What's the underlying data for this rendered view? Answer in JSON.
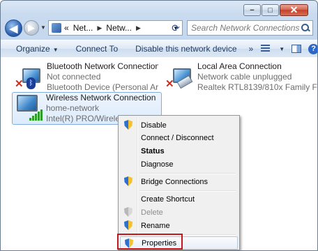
{
  "window": {
    "caption": {
      "minimize": "−",
      "maximize": "□",
      "close": "✕"
    }
  },
  "nav": {
    "back_glyph": "◀",
    "forward_glyph": "▶",
    "address": {
      "prefix": "«",
      "crumbs": [
        "Net...",
        "Netw..."
      ]
    },
    "search_placeholder": "Search Network Connections"
  },
  "toolbar": {
    "organize": "Organize",
    "connect_to": "Connect To",
    "disable": "Disable this network device",
    "more": "»"
  },
  "connections": [
    {
      "name": "Bluetooth Network Connection",
      "status": "Not connected",
      "device": "Bluetooth Device (Personal Area ..."
    },
    {
      "name": "Local Area Connection",
      "status": "Network cable unplugged",
      "device": "Realtek RTL8139/810x Family Fast ..."
    },
    {
      "name": "Wireless Network Connection",
      "status": "home-network",
      "device": "Intel(R) PRO/Wireless 3945ABG"
    }
  ],
  "context_menu": {
    "items": [
      {
        "label": "Disable"
      },
      {
        "label": "Connect / Disconnect"
      },
      {
        "label": "Status"
      },
      {
        "label": "Diagnose"
      },
      {
        "label": "Bridge Connections"
      },
      {
        "label": "Create Shortcut"
      },
      {
        "label": "Delete"
      },
      {
        "label": "Rename"
      },
      {
        "label": "Properties"
      }
    ]
  },
  "colors": {
    "highlight_box": "#c5181c",
    "window_chrome": "#c4d7ee",
    "selection": "#dcebfc"
  }
}
